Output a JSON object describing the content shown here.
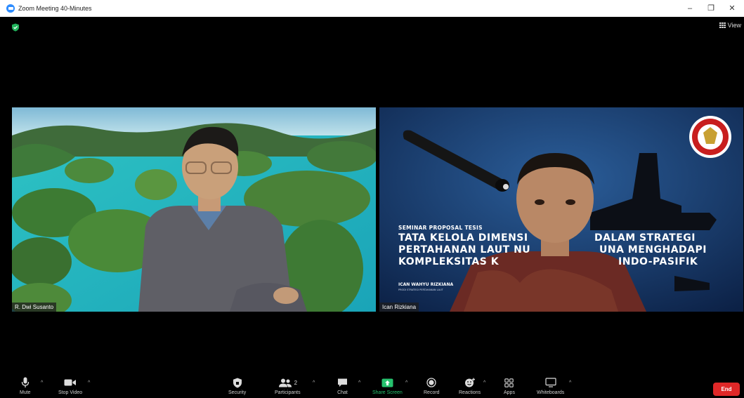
{
  "window": {
    "title": "Zoom Meeting 40-Minutes",
    "minimize_glyph": "–",
    "restore_glyph": "❐",
    "close_glyph": "✕"
  },
  "top": {
    "view_label": "View",
    "security_icon": "shield-check-icon"
  },
  "participants": [
    {
      "name": "R. Dwi Susanto"
    },
    {
      "name": "Ican Rizkiana"
    }
  ],
  "slide": {
    "seminar": "SEMINAR PROPOSAL TESIS",
    "line1": "TATA KELOLA DIMENSI",
    "line1b": "DALAM STRATEGI",
    "line2": "PERTAHANAN LAUT NU",
    "line2b": "UNA MENGHADAPI",
    "line3": "KOMPLEKSITAS K",
    "line3b": "INDO-PASIFIK",
    "author": "ICAN WAHYU RIZKIANA",
    "program": "PRODI STRATEGI PERTAHANAN LAUT"
  },
  "toolbar": {
    "mute": "Mute",
    "stop_video": "Stop Video",
    "security": "Security",
    "participants": "Participants",
    "participants_count": "2",
    "chat": "Chat",
    "share_screen": "Share Screen",
    "record": "Record",
    "reactions": "Reactions",
    "apps": "Apps",
    "whiteboards": "Whiteboards",
    "end": "End"
  },
  "colors": {
    "share_green": "#26C26E",
    "end_red": "#E02828",
    "zoom_blue": "#2D8CFF"
  }
}
